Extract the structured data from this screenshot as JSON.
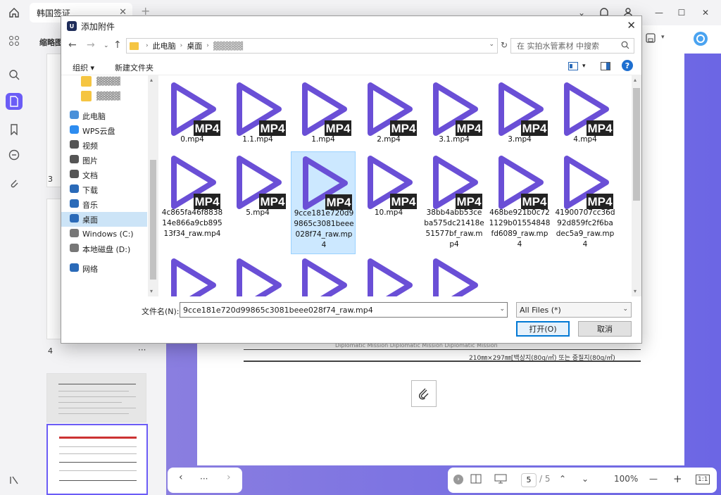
{
  "app": {
    "tab_title": "韩国签证",
    "thumb_panel_title": "缩略图",
    "thumb_page_3": "3",
    "thumb_page_4": "4",
    "more": "···"
  },
  "document": {
    "caption": "210㎜×297㎜[백상지(80g/㎡) 또는 중질지(80g/㎡)",
    "faint_text": "Diplomatic Mission                    Diplomatic Mission                    Diplomatic Mission"
  },
  "bottom_bar": {
    "more": "···",
    "current_page": "5",
    "total_pages": "/ 5",
    "zoom": "100%",
    "minus": "—",
    "plus": "+",
    "fit": "1:1"
  },
  "dialog": {
    "title": "添加附件",
    "breadcrumb": [
      "此电脑",
      "桌面",
      "▓▓▓▓▓"
    ],
    "search_placeholder": "在 实拍水管素材 中搜索",
    "organize": "组织 ▾",
    "new_folder": "新建文件夹",
    "nav_items": [
      {
        "label": "▓▓▓▓",
        "icon": "folder-icon"
      },
      {
        "label": "▓▓▓▓",
        "icon": "folder-icon"
      },
      {
        "label": "此电脑",
        "icon": "computer-icon"
      },
      {
        "label": "WPS云盘",
        "icon": "cloud-icon"
      },
      {
        "label": "视频",
        "icon": "video-icon"
      },
      {
        "label": "图片",
        "icon": "picture-icon"
      },
      {
        "label": "文档",
        "icon": "document-icon"
      },
      {
        "label": "下载",
        "icon": "download-icon"
      },
      {
        "label": "音乐",
        "icon": "music-icon"
      },
      {
        "label": "桌面",
        "icon": "desktop-icon"
      },
      {
        "label": "Windows (C:)",
        "icon": "drive-icon"
      },
      {
        "label": "本地磁盘 (D:)",
        "icon": "drive-icon"
      },
      {
        "label": "网络",
        "icon": "network-icon"
      }
    ],
    "badge": "MP4",
    "files": [
      "0.mp4",
      "1.1.mp4",
      "1.mp4",
      "2.mp4",
      "3.1.mp4",
      "3.mp4",
      "4.mp4",
      "4c865fa46f8838 14e866a9cb895 13f34_raw.mp4",
      "5.mp4",
      "9cce181e720d9 9865c3081beee 028f74_raw.mp 4",
      "10.mp4",
      "38bb4abb53ce ba575dc21418e 51577bf_raw.m p4",
      "468be921b0c72 1129b01554848 fd6089_raw.mp 4",
      "41900707cc36d 92d859fc2f6ba dec5a9_raw.mp 4",
      "",
      "",
      "",
      "",
      ""
    ],
    "filename_label": "文件名(N):",
    "filename_value": "9cce181e720d99865c3081beee028f74_raw.mp4",
    "filetype": "All Files (*)",
    "open": "打开(O)",
    "cancel": "取消"
  },
  "colors": {
    "accent": "#6b5cf6",
    "play": "#6a4fd6",
    "select": "#cce8ff"
  }
}
